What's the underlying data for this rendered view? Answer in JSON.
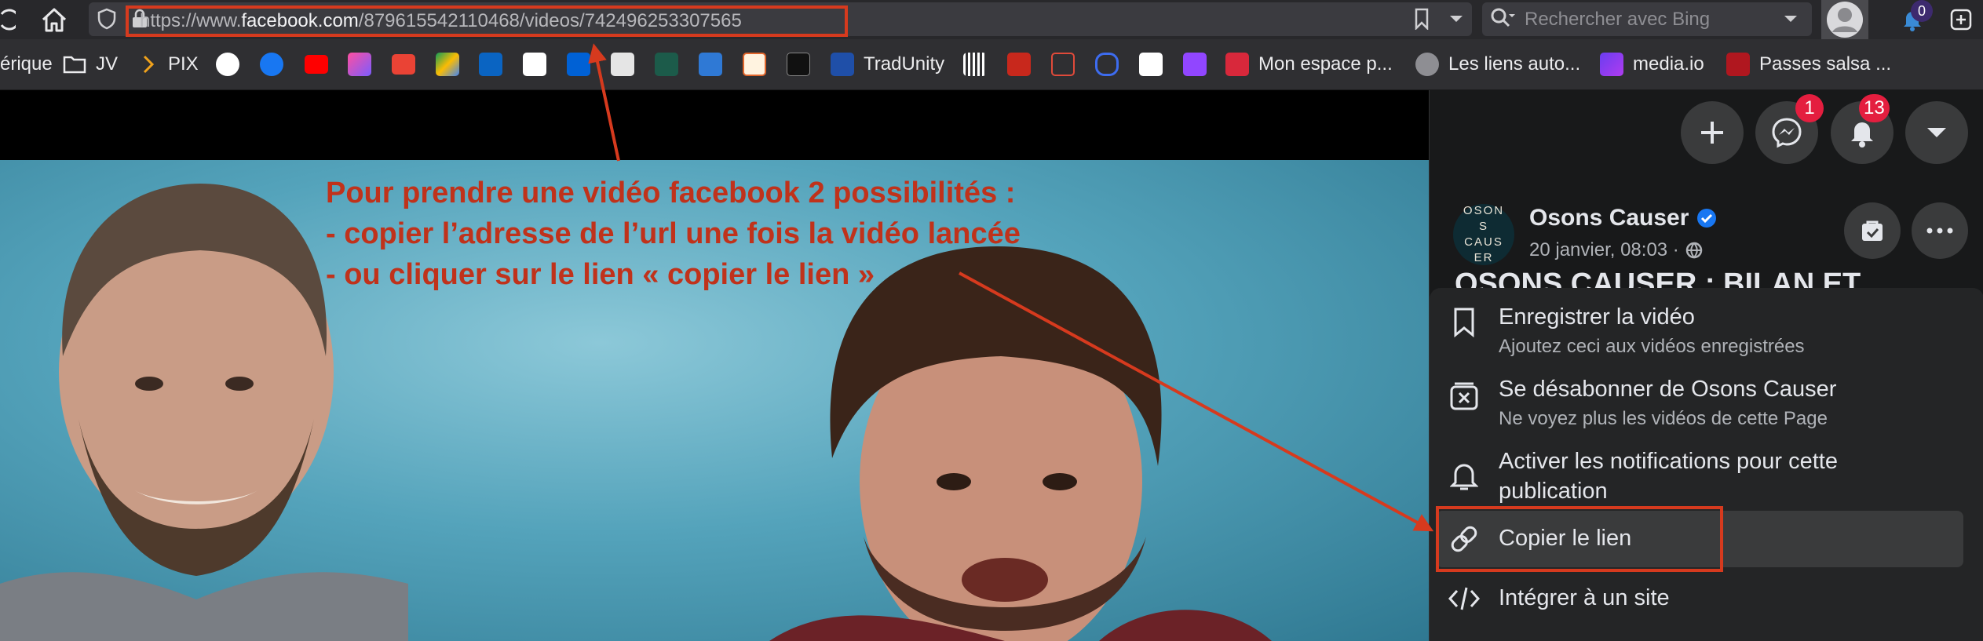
{
  "browser": {
    "url_prefix": "https://www.",
    "url_domain": "facebook.com",
    "url_path": "/879615542110468/videos/742496253307565",
    "search_placeholder": "Rechercher avec Bing",
    "notif_count": "0"
  },
  "bookmarks": [
    {
      "label": "érique",
      "icon": "folder-icon"
    },
    {
      "label": "JV",
      "icon": "folder-icon"
    },
    {
      "label": "PIX",
      "icon": "chevron-right-icon"
    },
    {
      "label": "TradUnity",
      "icon": "tradunity-icon"
    },
    {
      "label": "Mon espace p...",
      "icon": "profile-icon"
    },
    {
      "label": "Les liens auto...",
      "icon": "globe-icon"
    },
    {
      "label": "media.io",
      "icon": "media-io-icon"
    },
    {
      "label": "Passes salsa ...",
      "icon": "sg-icon"
    }
  ],
  "facebook": {
    "messenger_badge": "1",
    "notifications_badge": "13",
    "page_name": "Osons Causer",
    "avatar_text": "OSONS CAUSER",
    "post_date": "20 janvier, 08:03 ·",
    "post_title_partial": "OSONS CAUSER : BILAN ET",
    "menu": [
      {
        "title": "Enregistrer la vidéo",
        "subtitle": "Ajoutez ceci aux vidéos enregistrées",
        "icon": "bookmark-icon"
      },
      {
        "title": "Se désabonner de Osons Causer",
        "subtitle": "Ne voyez plus les vidéos de cette Page",
        "icon": "unfollow-icon"
      },
      {
        "title": "Activer les notifications pour cette publication",
        "subtitle": "",
        "icon": "bell-icon"
      },
      {
        "title": "Copier le lien",
        "subtitle": "",
        "icon": "link-icon"
      },
      {
        "title": "Intégrer à un site",
        "subtitle": "",
        "icon": "code-icon"
      }
    ]
  },
  "annotation": {
    "line1": "Pour prendre une vidéo facebook 2 possibilités :",
    "line2": "- copier l’adresse de l’url une fois la vidéo lancée",
    "line3": "- ou cliquer sur le lien « copier le lien »"
  },
  "colors": {
    "annotation_red": "#c0321b",
    "facebook_blue": "#1877f2",
    "badge_red": "#e41e3f"
  }
}
